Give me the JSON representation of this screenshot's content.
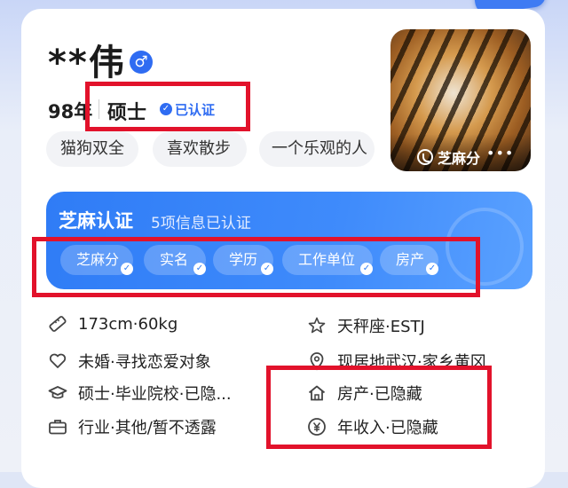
{
  "profile": {
    "name": "**伟",
    "gender_symbol": "♂",
    "age": "98年",
    "degree": "硕士",
    "verified_label": "已认证",
    "tags": [
      "猫狗双全",
      "喜欢散步",
      "一个乐观的人"
    ]
  },
  "avatar": {
    "badge_label": "芝麻分",
    "more_label": "•••"
  },
  "zhima": {
    "title": "芝麻认证",
    "subtitle": "5项信息已认证",
    "chips": [
      "芝麻分",
      "实名",
      "学历",
      "工作单位",
      "房产"
    ]
  },
  "details": {
    "height_weight": "173cm·60kg",
    "zodiac_mbti": "天秤座·ESTJ",
    "marriage": "未婚·寻找恋爱对象",
    "location": "现居地武汉·家乡黄冈",
    "education": "硕士·毕业院校·已隐...",
    "property": "房产·已隐藏",
    "industry": "行业·其他/暂不透露",
    "income": "年收入·已隐藏"
  },
  "icons": {
    "height": "ruler-icon",
    "zodiac": "star-icon",
    "marriage": "heart-icon",
    "location": "location-pin-icon",
    "education": "graduation-cap-icon",
    "property": "house-icon",
    "industry": "briefcase-icon",
    "income": "yen-icon"
  },
  "colors": {
    "accent": "#2f6cf2",
    "zhima_bg": "#3f8bfb",
    "highlight_box": "#e2122b"
  }
}
